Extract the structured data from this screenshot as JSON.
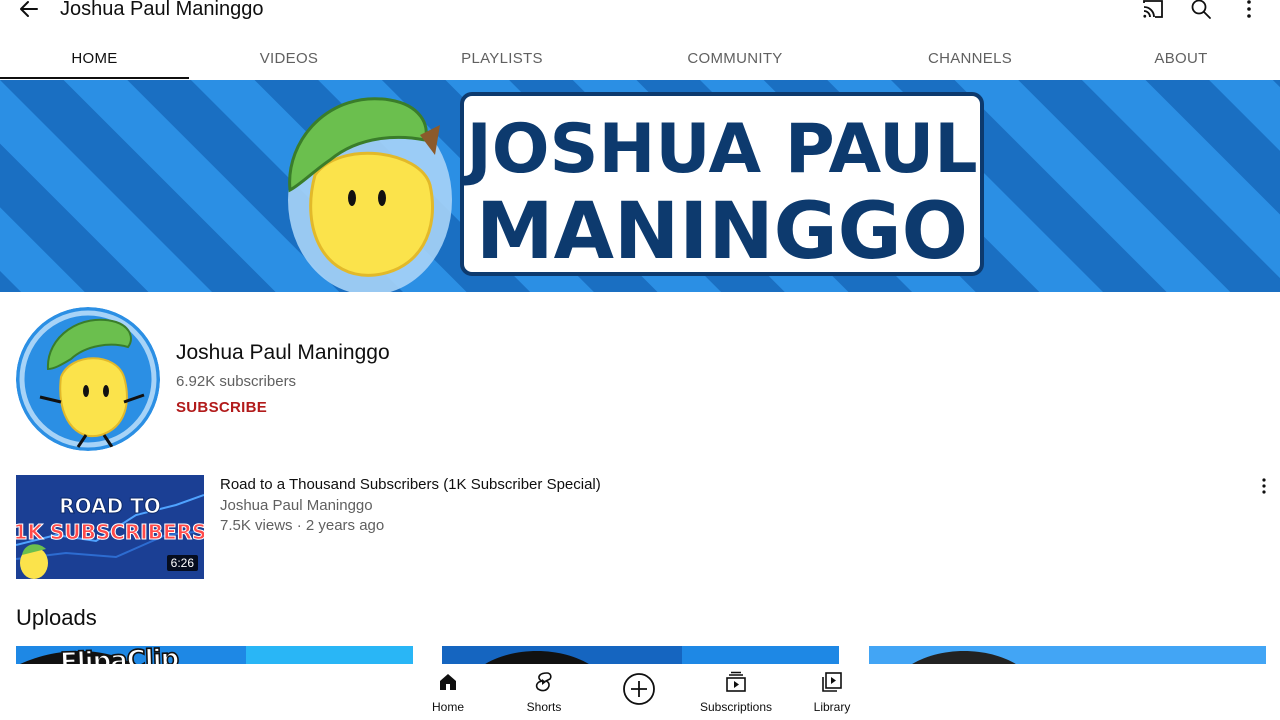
{
  "header": {
    "title": "Joshua Paul Maninggo",
    "icons": [
      "back-arrow-icon",
      "cast-icon",
      "search-icon",
      "more-vert-icon"
    ]
  },
  "tabs": [
    {
      "label": "HOME",
      "active": true
    },
    {
      "label": "VIDEOS",
      "active": false
    },
    {
      "label": "PLAYLISTS",
      "active": false
    },
    {
      "label": "COMMUNITY",
      "active": false
    },
    {
      "label": "CHANNELS",
      "active": false
    },
    {
      "label": "ABOUT",
      "active": false
    }
  ],
  "banner": {
    "line1": "JOSHUA PAUL",
    "line2": "MANINGGO"
  },
  "channel": {
    "name": "Joshua Paul Maninggo",
    "subscribers": "6.92K subscribers",
    "subscribe_label": "SUBSCRIBE"
  },
  "featured": {
    "title": "Road to a Thousand Subscribers (1K Subscriber Special)",
    "channel": "Joshua Paul Maninggo",
    "meta": "7.5K views · 2 years ago",
    "duration": "6:26",
    "thumb_line1": "ROAD TO",
    "thumb_line2": "1K SUBSCRIBERS"
  },
  "uploads": {
    "heading": "Uploads"
  },
  "watermark": "FlipaClip",
  "bottom_nav": [
    {
      "label": "Home",
      "icon": "home-icon"
    },
    {
      "label": "Shorts",
      "icon": "shorts-icon"
    },
    {
      "label": "",
      "icon": "create-icon"
    },
    {
      "label": "Subscriptions",
      "icon": "subscriptions-icon"
    },
    {
      "label": "Library",
      "icon": "library-icon"
    }
  ],
  "colors": {
    "accent_red": "#b21b1b",
    "banner_blue": "#2b8fe4",
    "text_secondary": "#606060"
  }
}
